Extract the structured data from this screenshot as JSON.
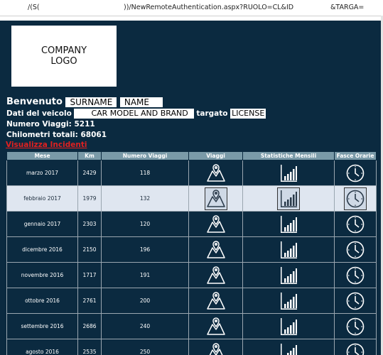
{
  "url": {
    "part1": "/(S(",
    "part2": "))/NewRemoteAuthentication.aspx?RUOLO=CL&ID",
    "part3": "&TARGA="
  },
  "logo": {
    "line1": "COMPANY",
    "line2": "LOGO"
  },
  "welcome": {
    "label": "Benvenuto",
    "surname": "SURNAME",
    "name": "NAME"
  },
  "vehicle": {
    "label": "Dati del veicolo",
    "model": "CAR MODEL AND BRAND",
    "targato_label": "targato",
    "license": "LICENSE"
  },
  "trips": {
    "label": "Numero Viaggi:",
    "value": "5211"
  },
  "km": {
    "label": "Chilometri totali:",
    "value": "68061"
  },
  "incidents_link": "Visualizza Incidenti",
  "table": {
    "headers": [
      "Mese",
      "Km",
      "Numero Viaggi",
      "Viaggi",
      "Statistiche Mensili",
      "Fasce Orarie"
    ],
    "rows": [
      {
        "mese": "marzo 2017",
        "km": "2429",
        "viaggi": "118"
      },
      {
        "mese": "febbraio 2017",
        "km": "1979",
        "viaggi": "132"
      },
      {
        "mese": "gennaio 2017",
        "km": "2303",
        "viaggi": "120"
      },
      {
        "mese": "dicembre 2016",
        "km": "2150",
        "viaggi": "196"
      },
      {
        "mese": "novembre 2016",
        "km": "1717",
        "viaggi": "191"
      },
      {
        "mese": "ottobre 2016",
        "km": "2761",
        "viaggi": "200"
      },
      {
        "mese": "settembre 2016",
        "km": "2686",
        "viaggi": "240"
      },
      {
        "mese": "agosto 2016",
        "km": "2535",
        "viaggi": "250"
      }
    ],
    "icons": {
      "viaggi": "map-pin-icon",
      "statistiche": "bar-chart-icon",
      "fasce": "clock-icon"
    },
    "highlighted_row": 1
  },
  "colors": {
    "panel": "#0b2a40",
    "header": "#7a9aa8",
    "highlight": "#dfe6f0",
    "link": "#e02020"
  }
}
